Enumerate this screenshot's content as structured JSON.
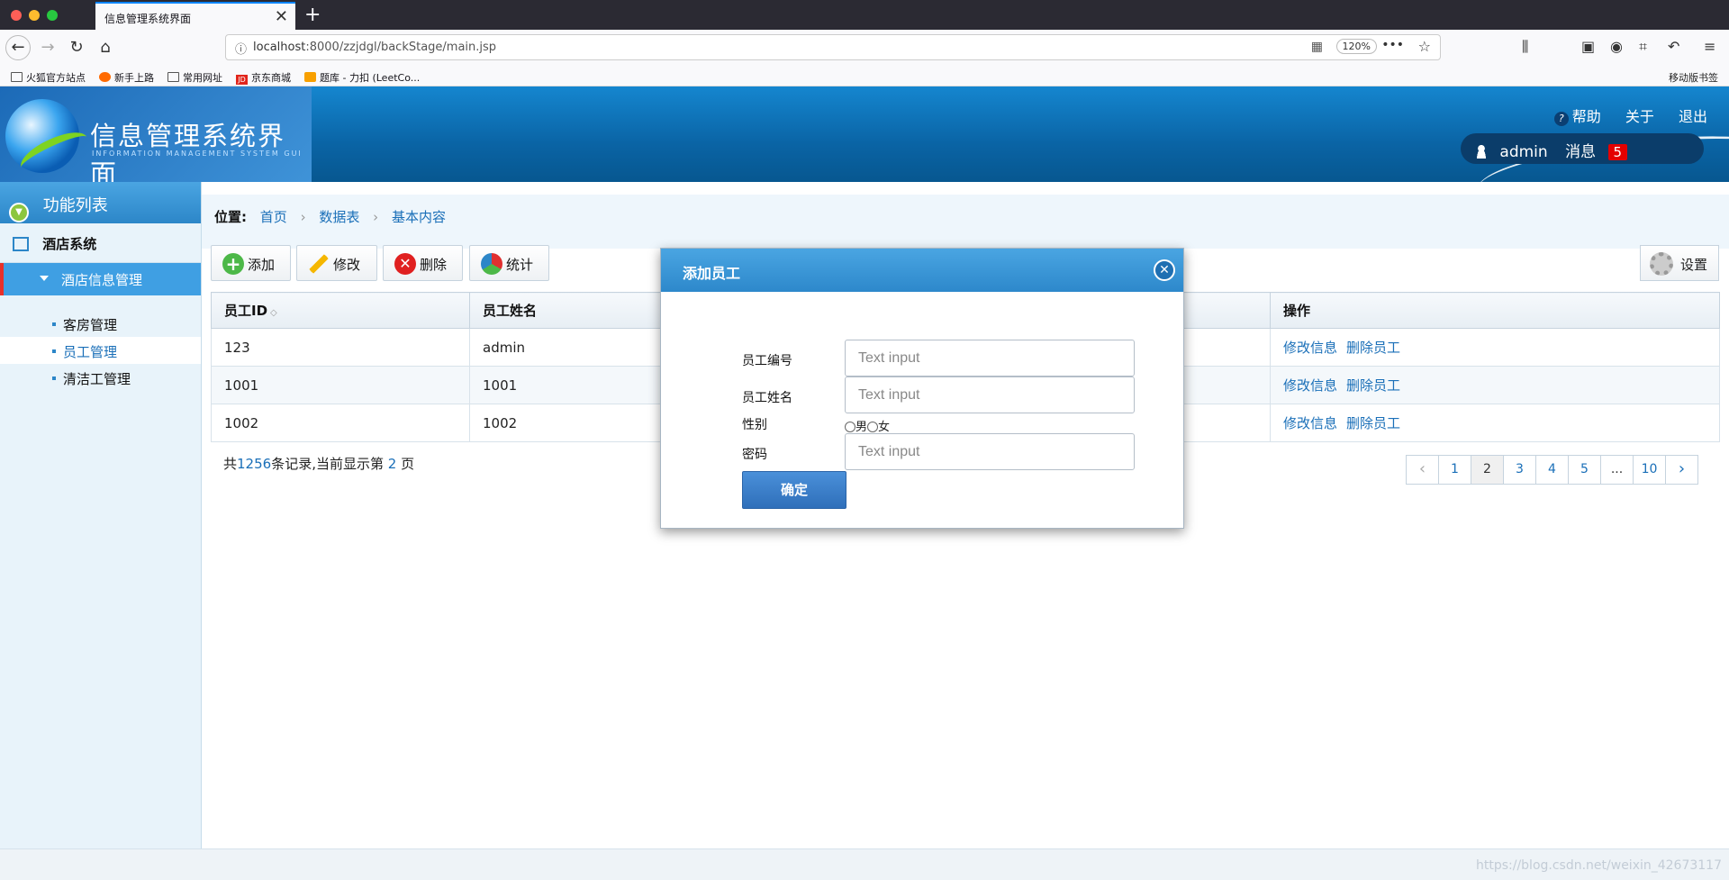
{
  "browser": {
    "tab_title": "信息管理系统界面",
    "tab_close": "✕",
    "new_tab": "+",
    "url_host": "localhost",
    "url_path": ":8000/zzjdgl/backStage/main.jsp",
    "zoom": "120%",
    "bookmarks": [
      "火狐官方站点",
      "新手上路",
      "常用网址",
      "京东商城",
      "题库 - 力扣 (LeetCo..."
    ],
    "jd_badge": "JD",
    "mobile_bookmarks": "移动版书签"
  },
  "header": {
    "title": "信息管理系统界面",
    "subtitle": "INFORMATION MANAGEMENT SYSTEM GUI",
    "help": "帮助",
    "about": "关于",
    "logout": "退出",
    "username": "admin",
    "messages_label": "消息",
    "messages_count": "5"
  },
  "sidebar": {
    "title": "功能列表",
    "group": "酒店系统",
    "submenu": "酒店信息管理",
    "items": [
      {
        "label": "客房管理"
      },
      {
        "label": "员工管理"
      },
      {
        "label": "清洁工管理"
      }
    ]
  },
  "main": {
    "location_label": "位置:",
    "breadcrumbs": [
      "首页",
      "数据表",
      "基本内容"
    ],
    "toolbar": {
      "add": "添加",
      "edit": "修改",
      "delete": "删除",
      "stats": "统计",
      "settings": "设置"
    },
    "table": {
      "headers": [
        "员工ID",
        "员工姓名",
        "操作"
      ],
      "rows": [
        {
          "id": "123",
          "name": "admin",
          "edit": "修改信息",
          "delete": "删除员工"
        },
        {
          "id": "1001",
          "name": "1001",
          "edit": "修改信息",
          "delete": "删除员工"
        },
        {
          "id": "1002",
          "name": "1002",
          "edit": "修改信息",
          "delete": "删除员工"
        }
      ]
    },
    "pager_info": {
      "prefix": "共",
      "total": "1256",
      "middle": "条记录,当前显示第",
      "page": "2",
      "suffix": "页"
    },
    "pager": [
      "1",
      "2",
      "3",
      "4",
      "5",
      "...",
      "10"
    ]
  },
  "modal": {
    "title": "添加员工",
    "fields": {
      "id_label": "员工编号",
      "name_label": "员工姓名",
      "gender_label": "性别",
      "password_label": "密码",
      "placeholder": "Text input"
    },
    "gender_options": [
      "男",
      "女"
    ],
    "confirm": "确定"
  },
  "watermark": "https://blog.csdn.net/weixin_42673117"
}
